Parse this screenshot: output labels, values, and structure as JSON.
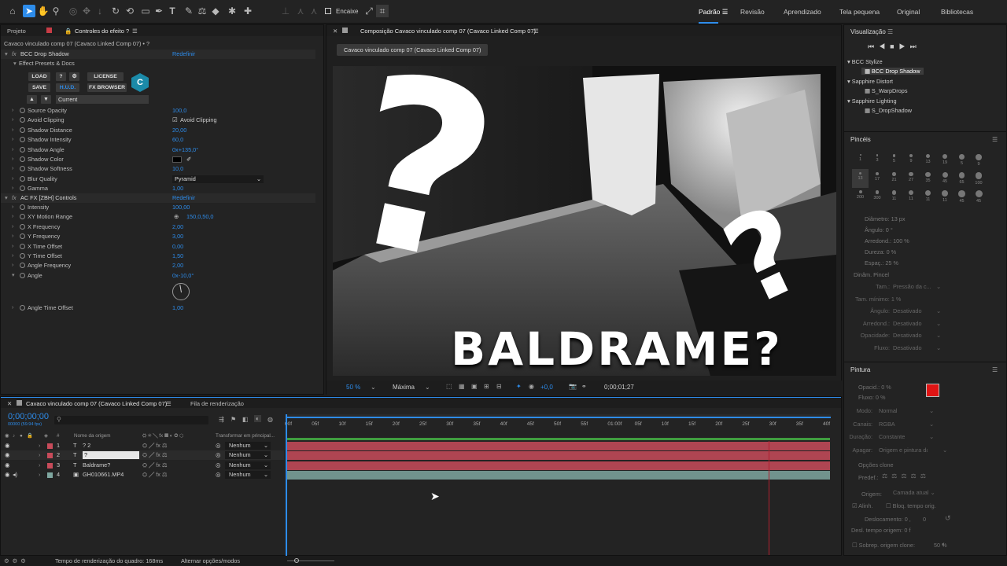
{
  "toolbar": {
    "snap_label": "Encaixe",
    "workspaces": [
      "Padrão",
      "Revisão",
      "Aprendizado",
      "Tela pequena",
      "Original",
      "Bibliotecas"
    ]
  },
  "effects_panel": {
    "tab_project": "Projeto",
    "tab_effects": "Controles do efeito ?",
    "breadcrumb": "Cavaco vinculado comp 07 (Cavaco Linked Comp 07) • ?",
    "bcc_name": "BCC Drop Shadow",
    "reset_label": "Redefinir",
    "presets_label": "Effect Presets & Docs",
    "btn_load": "LOAD",
    "btn_q": "?",
    "btn_license": "LICENSE",
    "btn_save": "SAVE",
    "btn_hud": "H.U.D.",
    "btn_fxbrowser": "FX BROWSER",
    "preset_current": "Current",
    "params": [
      {
        "label": "Source Opacity",
        "value": "100,0"
      },
      {
        "label": "Avoid Clipping",
        "value": "Avoid Clipping"
      },
      {
        "label": "Shadow Distance",
        "value": "20,00"
      },
      {
        "label": "Shadow Intensity",
        "value": "60,0"
      },
      {
        "label": "Shadow Angle",
        "value": "0x+135,0°"
      },
      {
        "label": "Shadow Color",
        "value": ""
      },
      {
        "label": "Shadow Softness",
        "value": "10,0"
      },
      {
        "label": "Blur Quality",
        "value": "Pyramid"
      },
      {
        "label": "Gamma",
        "value": "1,00"
      }
    ],
    "ac_name": "AC FX [ZBH] Controls",
    "ac_reset": "Redefinir",
    "ac_params": [
      {
        "label": "Intensity",
        "value": "100,00"
      },
      {
        "label": "XY Motion Range",
        "value": "150,0,50,0"
      },
      {
        "label": "X Frequency",
        "value": "2,00"
      },
      {
        "label": "Y Frequency",
        "value": "3,00"
      },
      {
        "label": "X Time Offset",
        "value": "0,00"
      },
      {
        "label": "Y Time Offset",
        "value": "1,50"
      },
      {
        "label": "Angle Frequency",
        "value": "2,00"
      },
      {
        "label": "Angle",
        "value": "0x-10,0°"
      }
    ],
    "angle_time_offset": {
      "label": "Angle Time Offset",
      "value": "1,00"
    }
  },
  "viewer": {
    "tab_title": "Composição Cavaco vinculado comp 07 (Cavaco Linked Comp 07)",
    "breadcrumb": "Cavaco vinculado comp 07 (Cavaco Linked Comp 07)",
    "frame_text": "BALDRAME?",
    "zoom": "50 %",
    "quality": "Máxima",
    "exposure": "+0,0",
    "timecode": "0;00;01;27"
  },
  "timeline": {
    "tab_comp": "Cavaco vinculado comp 07 (Cavaco Linked Comp 07)",
    "tab_render": "Fila de renderização",
    "timecode": "0;00;00;00",
    "timecode_sub": "00000 (59.94 fps)",
    "col_source": "Nome da origem",
    "col_parent": "Transformar em principal...",
    "ruler": [
      "00f",
      "05f",
      "10f",
      "15f",
      "20f",
      "25f",
      "30f",
      "35f",
      "40f",
      "45f",
      "50f",
      "55f",
      "01:00f",
      "05f",
      "10f",
      "15f",
      "20f",
      "25f",
      "30f",
      "35f",
      "40f"
    ],
    "layers": [
      {
        "num": "1",
        "name": "? 2",
        "parent": "Nenhum",
        "color": "#c84b5a"
      },
      {
        "num": "2",
        "name": "?",
        "parent": "Nenhum",
        "color": "#c84b5a"
      },
      {
        "num": "3",
        "name": "Baldrame?",
        "parent": "Nenhum",
        "color": "#c84b5a"
      },
      {
        "num": "4",
        "name": "GH010661.MP4",
        "parent": "Nenhum",
        "color": "#7fa7a0"
      }
    ]
  },
  "right": {
    "preview_title": "Visualização",
    "effects_tree": [
      {
        "group": "BCC Stylize",
        "item": "BCC Drop Shadow"
      },
      {
        "group": "Sapphire Distort",
        "item": "S_WarpDrops"
      },
      {
        "group": "Sapphire Lighting",
        "item": "S_DropShadow"
      }
    ],
    "brushes_title": "Pincéis",
    "brush_sizes": [
      "1",
      "3",
      "5",
      "9",
      "13",
      "19",
      "5",
      "9",
      "13",
      "17",
      "21",
      "27",
      "35",
      "45",
      "65",
      "100",
      "200",
      "300",
      "11",
      "11",
      "11",
      "11",
      "45",
      "45"
    ],
    "diameter": "Diâmetro: 13 px",
    "angle": "Ângulo: 0 °",
    "roundness": "Arredond.: 100 %",
    "hardness": "Dureza: 0 %",
    "spacing": "Espaç.: 25 %",
    "dynamics_title": "Dinâm. Pincel",
    "dynamics": [
      {
        "label": "Tam.:",
        "value": "Pressão da c..."
      },
      {
        "label": "Tam. mínimo: 1 %",
        "value": ""
      },
      {
        "label": "Ângulo:",
        "value": "Desativado"
      },
      {
        "label": "Arredond.:",
        "value": "Desativado"
      },
      {
        "label": "Opacidade:",
        "value": "Desativado"
      },
      {
        "label": "Fluxo:",
        "value": "Desativado"
      }
    ],
    "paint_title": "Pintura",
    "paint_opacity": "Opacid.: 0 %",
    "paint_flow": "Fluxo: 0 %",
    "paint_fields": [
      {
        "label": "Modo:",
        "value": "Normal"
      },
      {
        "label": "Canais:",
        "value": "RGBA"
      },
      {
        "label": "Duração:",
        "value": "Constante"
      },
      {
        "label": "Apagar:",
        "value": "Origem e pintura da..."
      }
    ],
    "clone_title": "Opções clone",
    "preset_label": "Predef.:",
    "source_label": "Origem:",
    "source_value": "Camada atual",
    "align": "Alinh.",
    "lock_time": "Bloq. tempo orig.",
    "offset": "Deslocamento: 0 ,",
    "offset2": "0",
    "source_time": "Desl. tempo origem: 0 f",
    "overlay": "Sobrep. origem clone:",
    "overlay_val": "50 %",
    "fg_color": "#e01414"
  },
  "status": {
    "render_time": "Tempo de renderização do quadro: 168ms",
    "toggle": "Alternar opções/modos"
  }
}
